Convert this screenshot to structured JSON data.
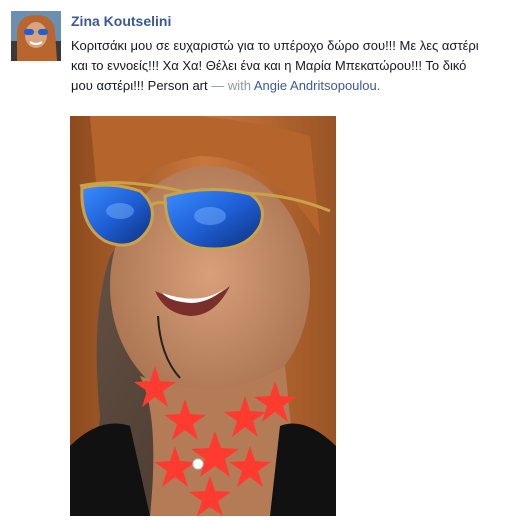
{
  "post": {
    "author_name": "Zina Koutselini",
    "message": "Κοριτσάκι μου σε ευχαριστώ για το υπέροχο δώρο σου!!! Με λες αστέρι και το εννοείς!!! Χα Χα! Θέλει ένα και η Μαρία Μπεκατώρου!!! Το δικό μου αστέρι!!! Person art",
    "with_separator": " — with ",
    "tagged_person": "Angie Andritsopoulou",
    "tag_end": "."
  },
  "colors": {
    "link": "#3b5998",
    "text": "#141823",
    "muted": "#9197a3",
    "hair": "#b8652e",
    "necklace": "#ff3b30",
    "lens": "#1f5fd6"
  },
  "icons": {
    "avatar": "profile-photo",
    "photo": "selfie-photo-starfish-necklace"
  }
}
